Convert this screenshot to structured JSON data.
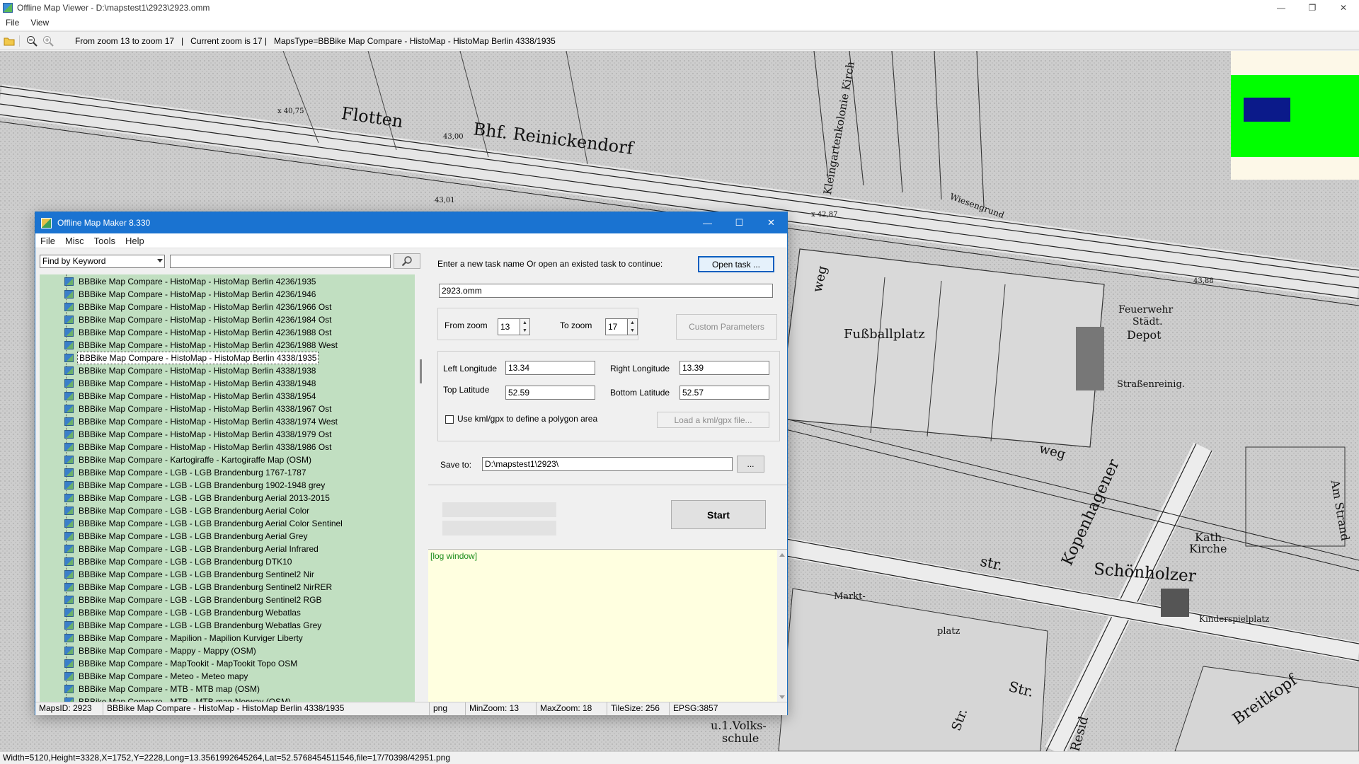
{
  "viewer": {
    "title": "Offline Map Viewer - D:\\mapstest1\\2923\\2923.omm",
    "menu": [
      "File",
      "View"
    ],
    "toolbar_info": "From zoom 13 to zoom 17   |   Current zoom is 17 |   MapsType=BBBike Map Compare - HistoMap - HistoMap Berlin 4338/1935",
    "status": "Width=5120,Height=3328,X=1752,Y=2228,Long=13.3561992645264,Lat=52.5768454511546,file=17/70398/42951.png"
  },
  "map": {
    "labels": {
      "flotten": "Flotten",
      "bhf": "Bhf. Reinickendorf",
      "fussball": "Fußballplatz",
      "feuerwehr1": "Feuerwehr",
      "feuerwehr2": "Städt.",
      "feuerwehr3": "Depot",
      "strassenreinig": "Straßenreinig.",
      "kleingarten": "Kleingartenkolonie Kirch",
      "wiesengrund": "Wiesengrund",
      "weg_left": "weg",
      "weg_mid": "weg",
      "kopenhagener": "Kopenhagener",
      "schoenholzer": "Schönholzer",
      "str1": "str.",
      "str2": "Str.",
      "str3": "Str.",
      "kath": "Kath.",
      "kirche": "Kirche",
      "kinderspielplatz": "Kinderspielplatz",
      "markt": "Markt-",
      "platz": "platz",
      "volksschule1": "u.1.Volks-",
      "volksschule2": "schule",
      "breitkopf": "Breitkopf",
      "residenz": "Resid",
      "amstrand": "Am Strand",
      "h4075": "x 40,75",
      "h4300": "43,00",
      "h4301": "43,01",
      "h4287": "x 42,87",
      "h4388": "43,88"
    },
    "colors": {
      "minimap_bg": "#fdf8e8",
      "minimap_view": "#00ff00",
      "minimap_rect": "#0b1a8a"
    }
  },
  "dialog": {
    "title": "Offline Map Maker 8.330",
    "menu": [
      "File",
      "Misc",
      "Tools",
      "Help"
    ],
    "find_mode": "Find by Keyword",
    "search_value": "",
    "tree_items": [
      "BBBike Map Compare - HistoMap - HistoMap Berlin 4236/1935",
      "BBBike Map Compare - HistoMap - HistoMap Berlin 4236/1946",
      "BBBike Map Compare - HistoMap - HistoMap Berlin 4236/1966 Ost",
      "BBBike Map Compare - HistoMap - HistoMap Berlin 4236/1984 Ost",
      "BBBike Map Compare - HistoMap - HistoMap Berlin 4236/1988 Ost",
      "BBBike Map Compare - HistoMap - HistoMap Berlin 4236/1988 West",
      "BBBike Map Compare - HistoMap - HistoMap Berlin 4338/1935",
      "BBBike Map Compare - HistoMap - HistoMap Berlin 4338/1938",
      "BBBike Map Compare - HistoMap - HistoMap Berlin 4338/1948",
      "BBBike Map Compare - HistoMap - HistoMap Berlin 4338/1954",
      "BBBike Map Compare - HistoMap - HistoMap Berlin 4338/1967 Ost",
      "BBBike Map Compare - HistoMap - HistoMap Berlin 4338/1974 West",
      "BBBike Map Compare - HistoMap - HistoMap Berlin 4338/1979 Ost",
      "BBBike Map Compare - HistoMap - HistoMap Berlin 4338/1986 Ost",
      "BBBike Map Compare - Kartogiraffe - Kartogiraffe Map (OSM)",
      "BBBike Map Compare - LGB - LGB Brandenburg 1767-1787",
      "BBBike Map Compare - LGB - LGB Brandenburg 1902-1948 grey",
      "BBBike Map Compare - LGB - LGB Brandenburg Aerial 2013-2015",
      "BBBike Map Compare - LGB - LGB Brandenburg Aerial Color",
      "BBBike Map Compare - LGB - LGB Brandenburg Aerial Color Sentinel",
      "BBBike Map Compare - LGB - LGB Brandenburg Aerial Grey",
      "BBBike Map Compare - LGB - LGB Brandenburg Aerial Infrared",
      "BBBike Map Compare - LGB - LGB Brandenburg DTK10",
      "BBBike Map Compare - LGB - LGB Brandenburg Sentinel2 Nir",
      "BBBike Map Compare - LGB - LGB Brandenburg Sentinel2 NirRER",
      "BBBike Map Compare - LGB - LGB Brandenburg Sentinel2 RGB",
      "BBBike Map Compare - LGB - LGB Brandenburg Webatlas",
      "BBBike Map Compare - LGB - LGB Brandenburg Webatlas Grey",
      "BBBike Map Compare - Mapilion - Mapilion Kurviger Liberty",
      "BBBike Map Compare - Mappy - Mappy (OSM)",
      "BBBike Map Compare - MapTookit - MapTookit Topo OSM",
      "BBBike Map Compare - Meteo - Meteo mapy",
      "BBBike Map Compare - MTB - MTB map (OSM)",
      "BBBike Map Compare - MTB - MTB map Norway (OSM)"
    ],
    "selected_index": 6,
    "task_prompt": "Enter a new task name Or open an existed task to continue:",
    "open_task_label": "Open task ...",
    "task_name": "2923.omm",
    "from_zoom_label": "From zoom",
    "from_zoom": "13",
    "to_zoom_label": "To zoom",
    "to_zoom": "17",
    "custom_params_label": "Custom Parameters",
    "left_lon_label": "Left Longitude",
    "left_lon": "13.34",
    "right_lon_label": "Right Longitude",
    "right_lon": "13.39",
    "top_lat_label": "Top Latitude",
    "top_lat": "52.59",
    "bottom_lat_label": "Bottom Latitude",
    "bottom_lat": "52.57",
    "use_kml_label": "Use kml/gpx to define a polygon area",
    "load_kml_label": "Load a kml/gpx file...",
    "save_to_label": "Save to:",
    "save_to": "D:\\mapstest1\\2923\\",
    "browse_label": "...",
    "start_label": "Start",
    "log_text": "[log window]",
    "status": {
      "maps_id": "MapsID: 2923",
      "map_name": "BBBike Map Compare - HistoMap - HistoMap Berlin 4338/1935",
      "format": "png",
      "min_zoom": "MinZoom: 13",
      "max_zoom": "MaxZoom: 18",
      "tile_size": "TileSize: 256",
      "epsg": "EPSG:3857"
    }
  }
}
